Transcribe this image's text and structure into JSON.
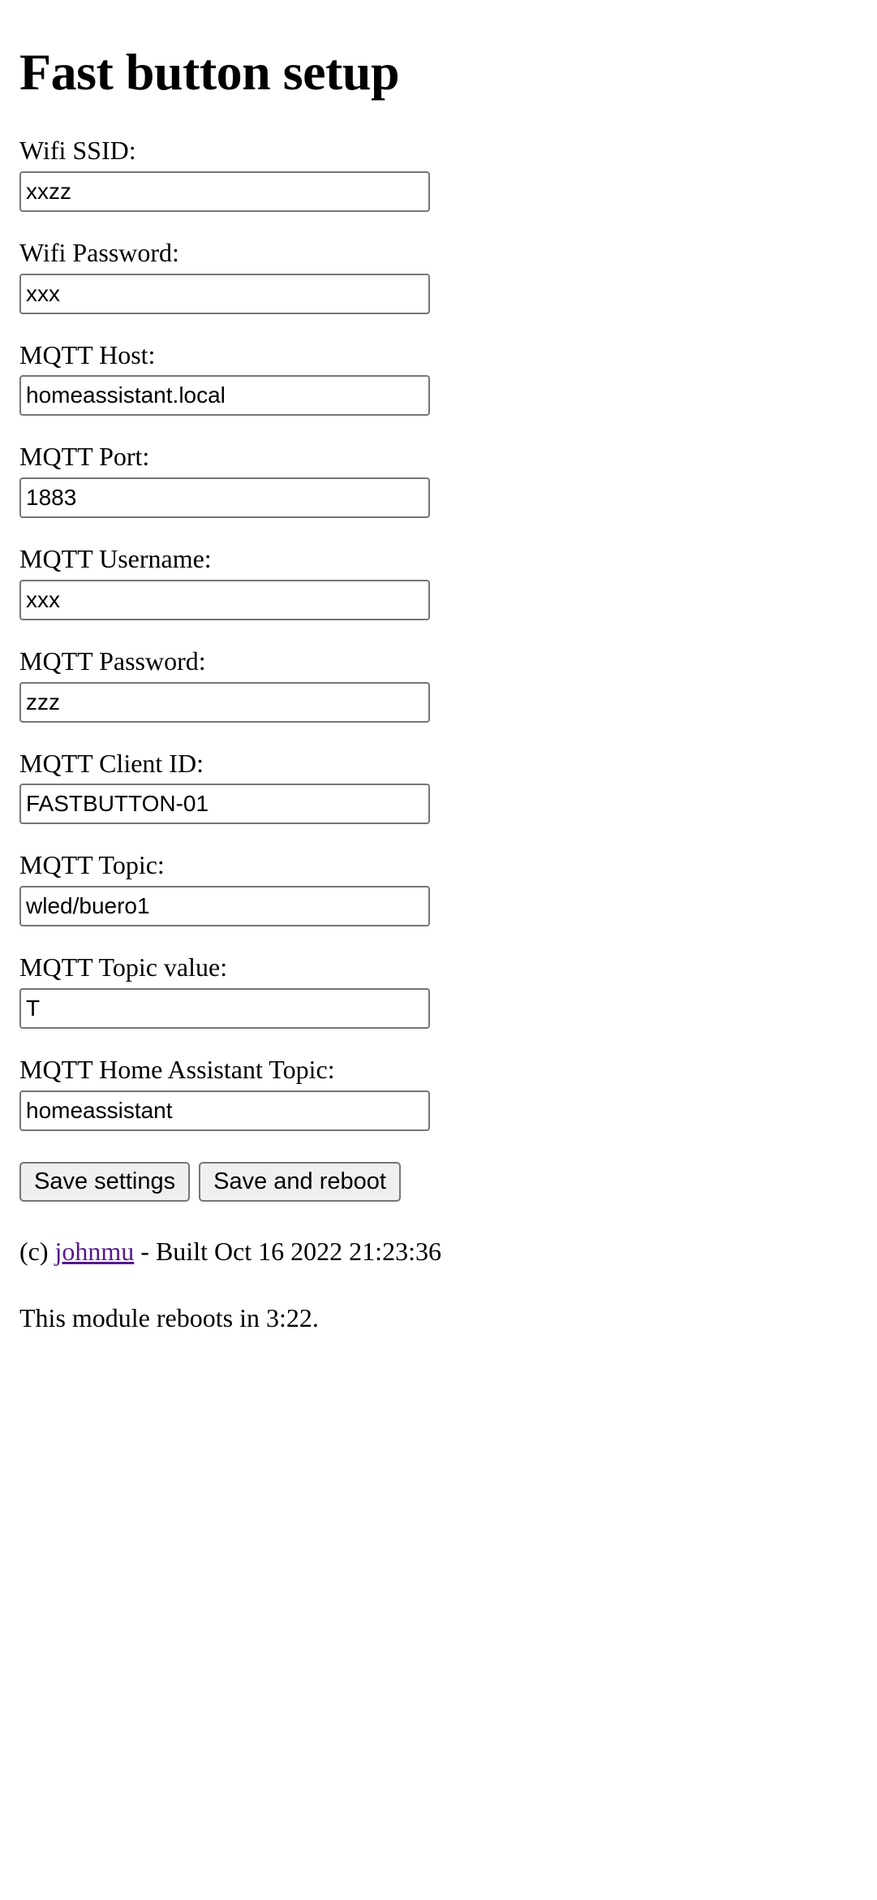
{
  "page": {
    "title": "Fast button setup"
  },
  "form": {
    "fields": [
      {
        "label": "Wifi SSID:",
        "value": "xxzz",
        "name": "wifi-ssid"
      },
      {
        "label": "Wifi Password:",
        "value": "xxx",
        "name": "wifi-password"
      },
      {
        "label": "MQTT Host:",
        "value": "homeassistant.local",
        "name": "mqtt-host"
      },
      {
        "label": "MQTT Port:",
        "value": "1883",
        "name": "mqtt-port"
      },
      {
        "label": "MQTT Username:",
        "value": "xxx",
        "name": "mqtt-username"
      },
      {
        "label": "MQTT Password:",
        "value": "zzz",
        "name": "mqtt-password"
      },
      {
        "label": "MQTT Client ID:",
        "value": "FASTBUTTON-01",
        "name": "mqtt-client-id"
      },
      {
        "label": "MQTT Topic:",
        "value": "wled/buero1",
        "name": "mqtt-topic"
      },
      {
        "label": "MQTT Topic value:",
        "value": "T",
        "name": "mqtt-topic-value"
      },
      {
        "label": "MQTT Home Assistant Topic:",
        "value": "homeassistant",
        "name": "mqtt-home-assistant-topic"
      }
    ],
    "buttons": {
      "save_label": "Save settings",
      "save_reboot_label": "Save and reboot"
    }
  },
  "footer": {
    "copyright_prefix": "(c) ",
    "credit_link": "johnmu",
    "build_text": " - Built Oct 16 2022 21:23:36",
    "reboot_notice": "This module reboots in 3:22."
  },
  "colors": {
    "link": "#551a8b",
    "input_border": "#767676",
    "button_background": "#efefef",
    "text": "#000000",
    "background": "#ffffff"
  }
}
